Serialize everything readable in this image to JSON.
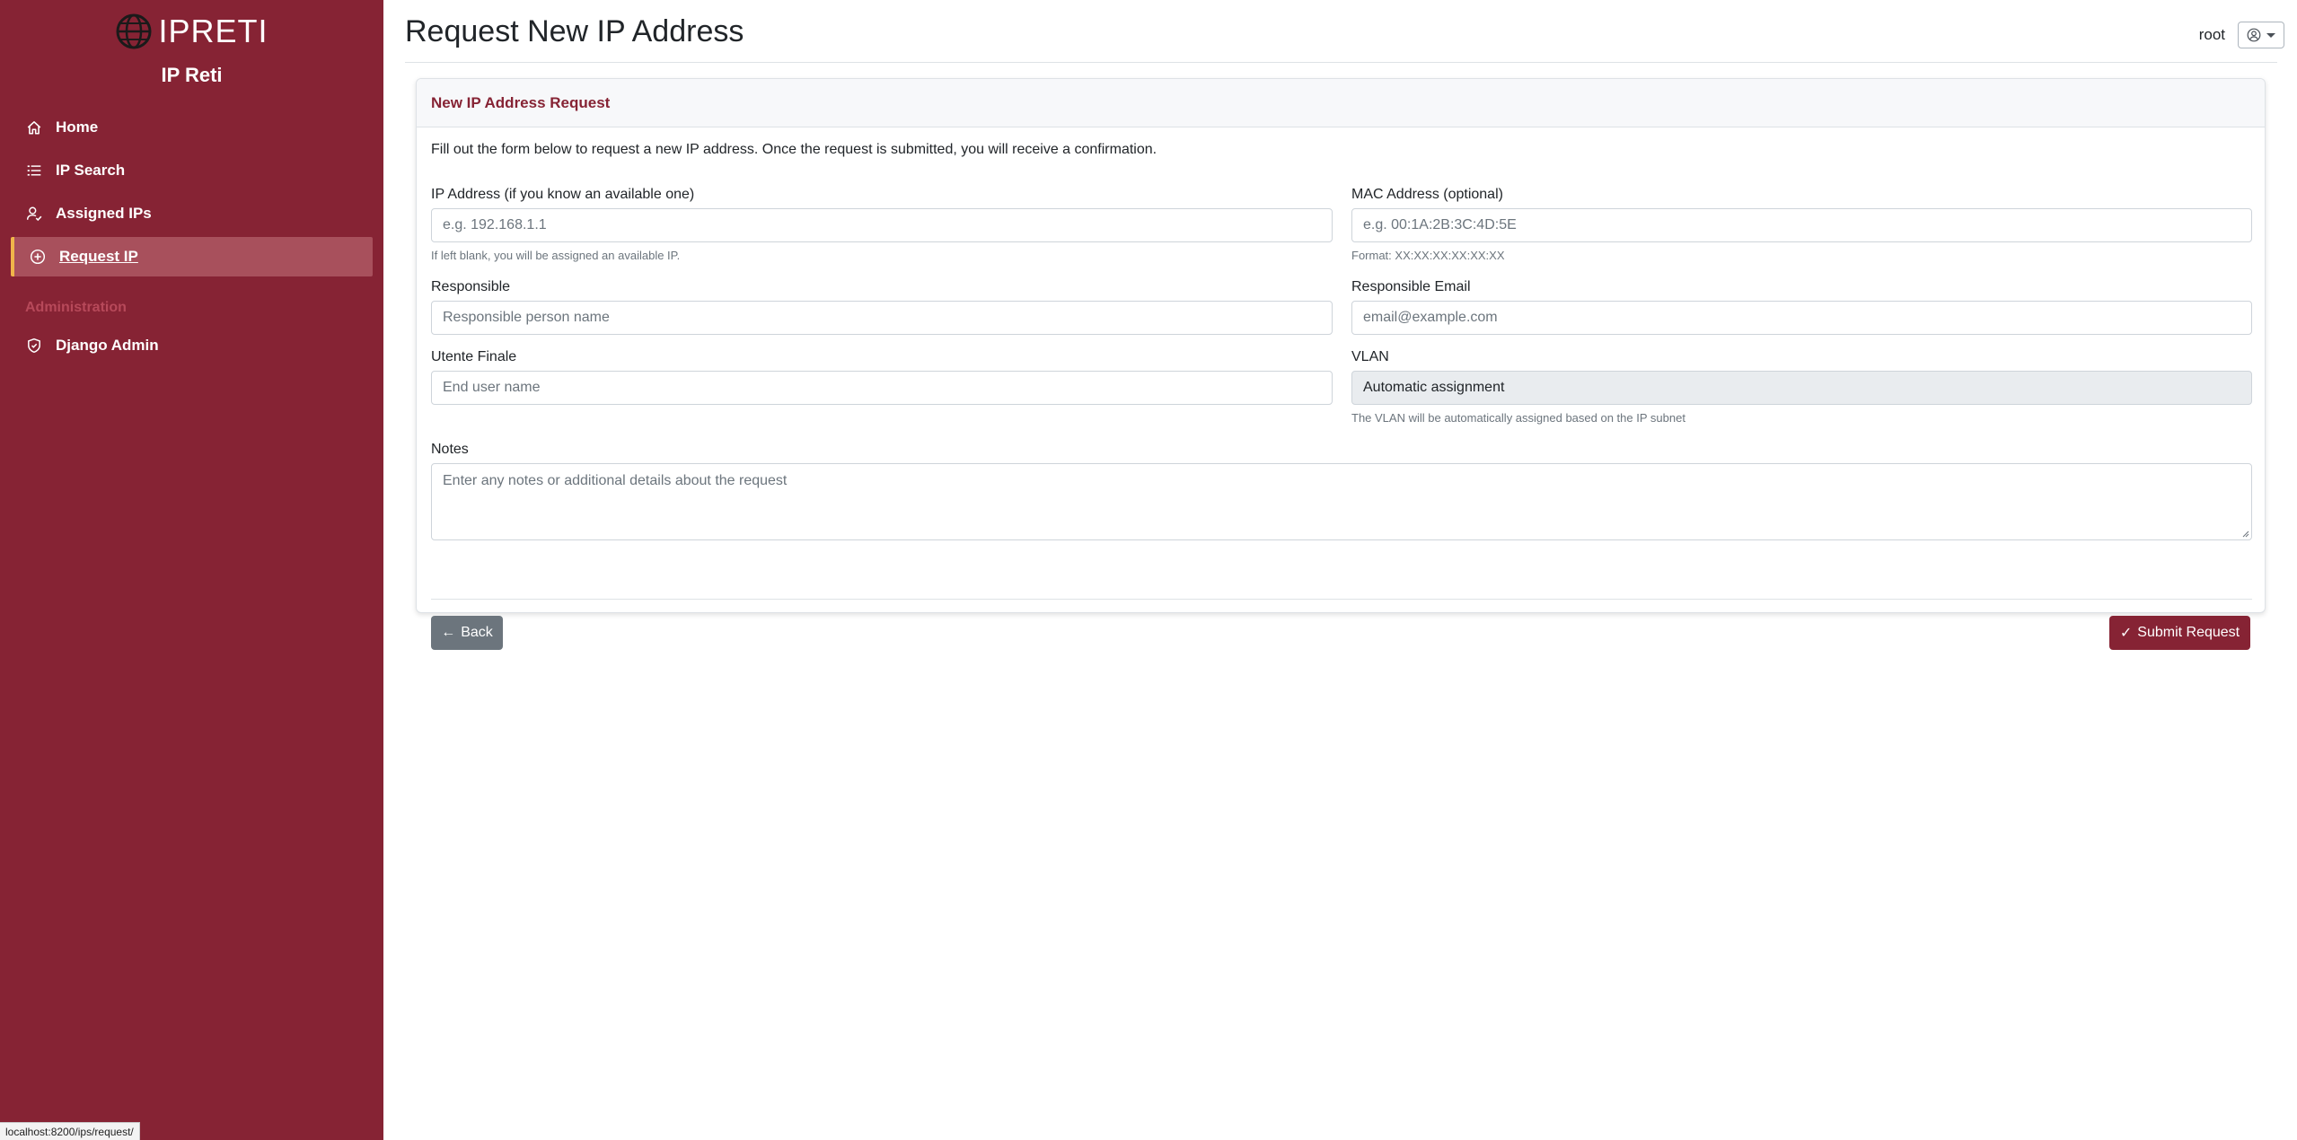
{
  "brand": {
    "logo_text": "IPRETI",
    "subtitle": "IP Reti"
  },
  "sidebar": {
    "items": [
      {
        "label": "Home",
        "icon": "home-icon"
      },
      {
        "label": "IP Search",
        "icon": "list-icon"
      },
      {
        "label": "Assigned IPs",
        "icon": "person-check-icon"
      },
      {
        "label": "Request IP",
        "icon": "plus-circle-icon",
        "active": true
      }
    ],
    "admin_heading": "Administration",
    "admin_items": [
      {
        "label": "Django Admin",
        "icon": "shield-icon"
      }
    ]
  },
  "header": {
    "title": "Request New IP Address",
    "username": "root"
  },
  "card": {
    "title": "New IP Address Request",
    "intro": "Fill out the form below to request a new IP address. Once the request is submitted, you will receive a confirmation."
  },
  "form": {
    "ip": {
      "label": "IP Address (if you know an available one)",
      "placeholder": "e.g. 192.168.1.1",
      "help": "If left blank, you will be assigned an available IP."
    },
    "mac": {
      "label": "MAC Address (optional)",
      "placeholder": "e.g. 00:1A:2B:3C:4D:5E",
      "help": "Format: XX:XX:XX:XX:XX:XX"
    },
    "responsible": {
      "label": "Responsible",
      "placeholder": "Responsible person name"
    },
    "responsible_email": {
      "label": "Responsible Email",
      "placeholder": "email@example.com"
    },
    "utente_finale": {
      "label": "Utente Finale",
      "placeholder": "End user name"
    },
    "vlan": {
      "label": "VLAN",
      "value": "Automatic assignment",
      "help": "The VLAN will be automatically assigned based on the IP subnet"
    },
    "notes": {
      "label": "Notes",
      "placeholder": "Enter any notes or additional details about the request"
    }
  },
  "buttons": {
    "back": "Back",
    "submit": "Submit Request"
  },
  "status_bar": {
    "url": "localhost:8200/ips/request/"
  },
  "colors": {
    "primary": "#862334",
    "accent": "#f0b54a",
    "secondary": "#6c757d"
  }
}
